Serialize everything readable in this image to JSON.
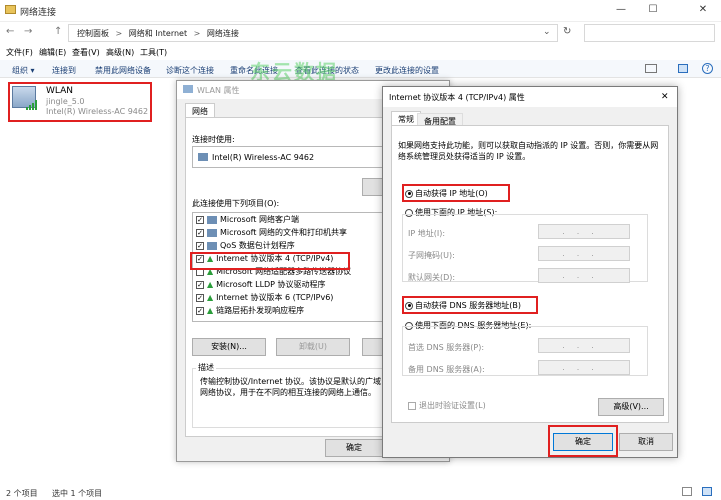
{
  "window": {
    "title": "网络连接",
    "controls": {
      "minimize": "—",
      "maximize": "☐",
      "close": "✕"
    }
  },
  "address": {
    "nav": {
      "back": "←",
      "forward": "→",
      "up": "↑"
    },
    "crumbs": [
      "控制面板",
      "网络和 Internet",
      "网络连接"
    ],
    "sep": ">",
    "dropdown": "⌄",
    "refresh": "↻"
  },
  "menu": [
    "文件(F)",
    "编辑(E)",
    "查看(V)",
    "高级(N)",
    "工具(T)"
  ],
  "commands": [
    "组织 ▾",
    "连接到",
    "禁用此网络设备",
    "诊断这个连接",
    "重命名此连接",
    "查看此连接的状态",
    "更改此连接的设置"
  ],
  "watermark": "东云数据",
  "adapter": {
    "name": "WLAN",
    "network": "jingle_5.0",
    "device": "Intel(R) Wireless-AC 9462"
  },
  "status": {
    "count": "2 个项目",
    "selected": "选中 1 个项目"
  },
  "wlan_dialog": {
    "title": "WLAN 属性",
    "tab": "网络",
    "connect_using_label": "连接时使用:",
    "device": "Intel(R) Wireless-AC 9462",
    "items_label": "此连接使用下列项目(O):",
    "items": [
      {
        "label": "Microsoft 网络客户端",
        "checked": true
      },
      {
        "label": "Microsoft 网络的文件和打印机共享",
        "checked": true
      },
      {
        "label": "QoS 数据包计划程序",
        "checked": true
      },
      {
        "label": "Internet 协议版本 4 (TCP/IPv4)",
        "checked": true
      },
      {
        "label": "Microsoft 网络适配器多路传送器协议",
        "checked": false
      },
      {
        "label": "Microsoft LLDP 协议驱动程序",
        "checked": true
      },
      {
        "label": "Internet 协议版本 6 (TCP/IPv6)",
        "checked": true
      },
      {
        "label": "链路层拓扑发现响应程序",
        "checked": true
      }
    ],
    "install": "安装(N)...",
    "uninstall": "卸载(U)",
    "description_label": "描述",
    "description": "传输控制协议/Internet 协议。该协议是默认的广域网络协议，用于在不同的相互连接的网络上通信。",
    "ok": "确定"
  },
  "ipv4_dialog": {
    "title": "Internet 协议版本 4 (TCP/IPv4) 属性",
    "close": "✕",
    "tabs": [
      "常规",
      "备用配置"
    ],
    "intro": "如果网络支持此功能，则可以获取自动指派的 IP 设置。否则，你需要从网络系统管理员处获得适当的 IP 设置。",
    "auto_ip": "自动获得 IP 地址(O)",
    "manual_ip": "使用下面的 IP 地址(S):",
    "ip_label": "IP 地址(I):",
    "mask_label": "子网掩码(U):",
    "gateway_label": "默认网关(D):",
    "auto_dns": "自动获得 DNS 服务器地址(B)",
    "manual_dns": "使用下面的 DNS 服务器地址(E):",
    "pref_dns_label": "首选 DNS 服务器(P):",
    "alt_dns_label": "备用 DNS 服务器(A):",
    "ip_dots": "...",
    "validate": "退出时验证设置(L)",
    "advanced": "高级(V)...",
    "ok": "确定",
    "cancel": "取消"
  },
  "colors": {
    "highlight_box": "#e02020",
    "accent": "#0078d7"
  }
}
